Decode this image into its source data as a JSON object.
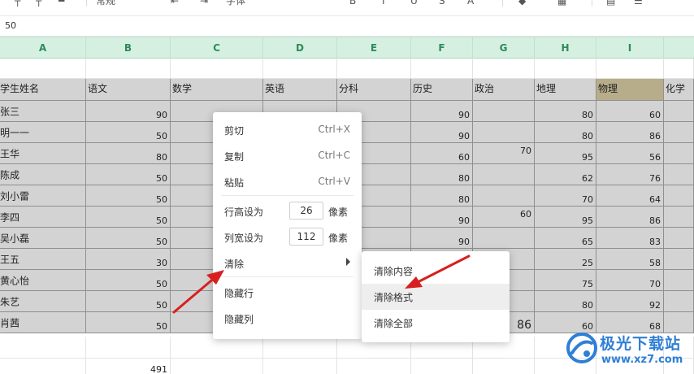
{
  "toolbar": {
    "items": [
      "常规",
      "字体"
    ]
  },
  "formula_bar": {
    "value": "50"
  },
  "columns": [
    "A",
    "B",
    "C",
    "D",
    "E",
    "F",
    "G",
    "H",
    "I"
  ],
  "header_row": [
    "学生姓名",
    "语文",
    "数学",
    "英语",
    "分科",
    "历史",
    "政治",
    "地理",
    "物理",
    "化学"
  ],
  "rows": [
    {
      "name": "张三",
      "B": "90",
      "F": "90",
      "G": "",
      "H": "80",
      "I": "60"
    },
    {
      "name": "明一一",
      "B": "50",
      "F": "90",
      "G": "",
      "H": "80",
      "I": "86"
    },
    {
      "name": "王华",
      "B": "80",
      "F": "60",
      "G": "70",
      "H": "95",
      "I": "56"
    },
    {
      "name": "陈成",
      "B": "50",
      "F": "80",
      "G": "",
      "H": "62",
      "I": "76"
    },
    {
      "name": "刘小雷",
      "B": "50",
      "F": "80",
      "G": "",
      "H": "70",
      "I": "64"
    },
    {
      "name": "李四",
      "B": "50",
      "F": "90",
      "G": "60",
      "H": "95",
      "I": "86"
    },
    {
      "name": "吴小磊",
      "B": "50",
      "F": "90",
      "G": "",
      "H": "65",
      "I": "83"
    },
    {
      "name": "王五",
      "B": "30",
      "F": "",
      "G": "",
      "H": "25",
      "I": "58"
    },
    {
      "name": "黄心怡",
      "B": "50",
      "F": "",
      "G": "",
      "H": "75",
      "I": "70"
    },
    {
      "name": "朱艺",
      "B": "50",
      "F": "",
      "G": "",
      "H": "80",
      "I": "92"
    },
    {
      "name": "肖茜",
      "B": "50",
      "F": "",
      "G": "86",
      "H": "60",
      "I": "68"
    }
  ],
  "total_row": {
    "B": "491"
  },
  "context_menu": {
    "cut": {
      "label": "剪切",
      "shortcut": "Ctrl+X"
    },
    "copy": {
      "label": "复制",
      "shortcut": "Ctrl+C"
    },
    "paste": {
      "label": "粘贴",
      "shortcut": "Ctrl+V"
    },
    "row_height": {
      "label": "行高设为",
      "value": "26",
      "unit": "像素"
    },
    "col_width": {
      "label": "列宽设为",
      "value": "112",
      "unit": "像素"
    },
    "clear": {
      "label": "清除"
    },
    "hide_row": {
      "label": "隐藏行"
    },
    "hide_col": {
      "label": "隐藏列"
    }
  },
  "submenu": {
    "clear_content": "清除内容",
    "clear_format": "清除格式",
    "clear_all": "清除全部"
  },
  "watermark": {
    "title": "极光下载站",
    "url": "www.xz7.com"
  },
  "colors": {
    "header_green": "#d5f0e1",
    "col_letter": "#2e8b57",
    "cell_gray": "#d3d3d3",
    "arrow_red": "#e02020",
    "highlight": "#b8ad8a"
  }
}
